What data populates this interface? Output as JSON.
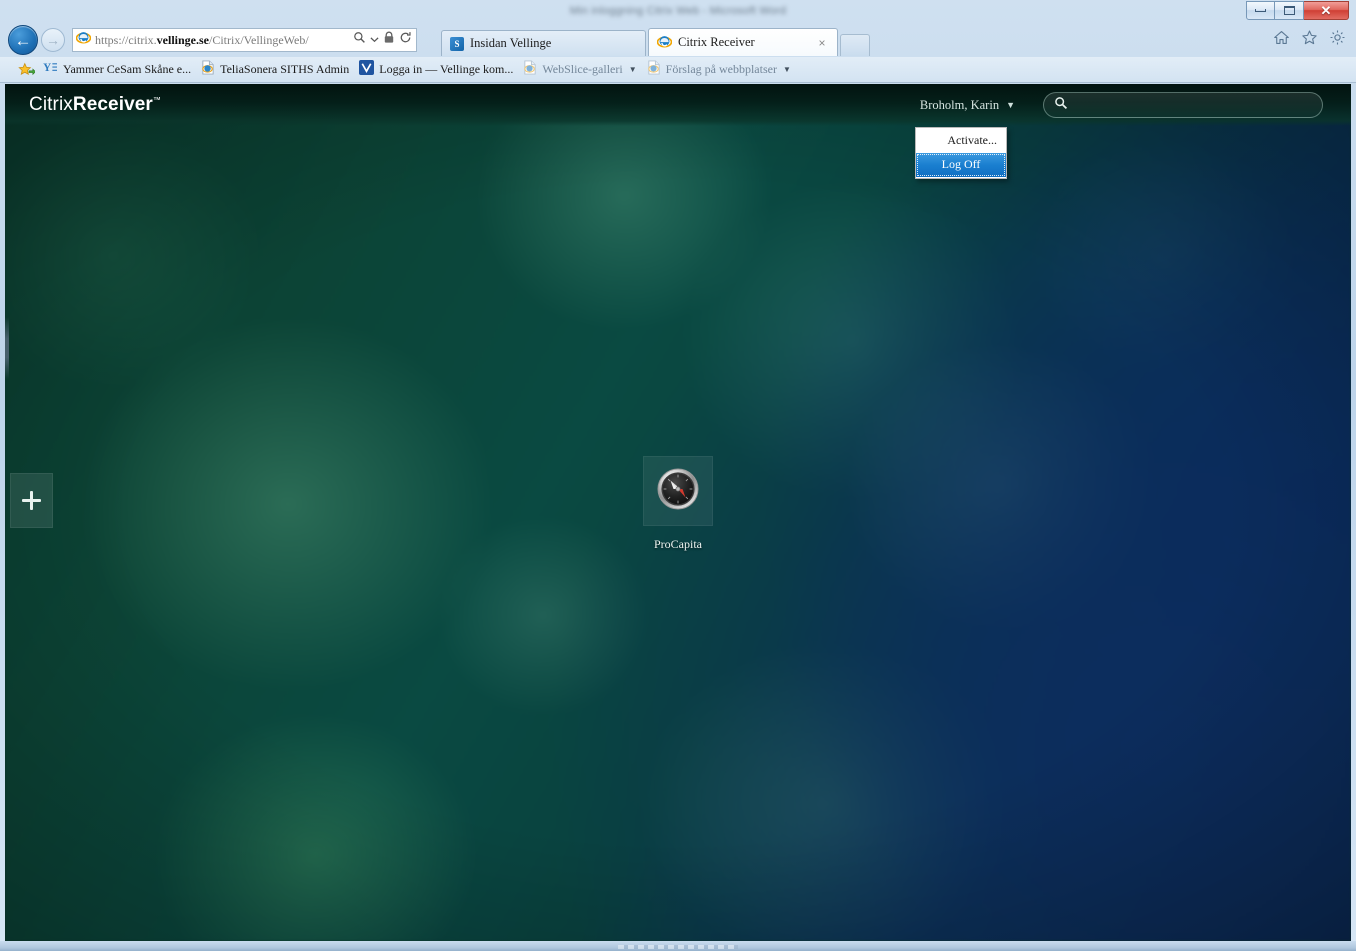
{
  "window": {
    "title": "Min inloggning Citrix Web - Microsoft Word",
    "minimize_label": "Minimize",
    "maximize_label": "Restore Down",
    "close_label": "Close"
  },
  "browser": {
    "back_label": "Back",
    "forward_label": "Forward",
    "url": "https://citrix.vellinge.se/Citrix/VellingeWeb/",
    "url_parts": {
      "scheme": "https://",
      "host_pre": "citrix.",
      "host_bold": "vellinge.se",
      "path": "/Citrix/VellingeWeb/"
    },
    "search_icon": "search-icon",
    "dropdown_icon": "chevron-down-icon",
    "lock_icon": "lock-icon",
    "refresh_icon": "refresh-icon",
    "tabs": [
      {
        "label": "Insidan Vellinge",
        "icon": "sharepoint-icon",
        "active": false,
        "closable": false
      },
      {
        "label": "Citrix Receiver",
        "icon": "ie-icon",
        "active": true,
        "closable": true,
        "close_label": "×"
      }
    ],
    "new_tab_label": "",
    "command_icons": [
      {
        "name": "home-icon",
        "label": "Home"
      },
      {
        "name": "favorites-star-icon",
        "label": "Favorites"
      },
      {
        "name": "gear-icon",
        "label": "Tools"
      }
    ],
    "favorites": [
      {
        "label": "Yammer  CeSam Skåne e...",
        "icon": "yammer-icon",
        "muted": false,
        "caret": false
      },
      {
        "label": "TeliaSonera SITHS Admin",
        "icon": "ie-page-icon",
        "muted": false,
        "caret": false
      },
      {
        "label": "Logga in — Vellinge kom...",
        "icon": "vellinge-icon",
        "muted": false,
        "caret": false
      },
      {
        "label": "WebSlice-galleri",
        "icon": "ie-page-icon",
        "muted": true,
        "caret": true
      },
      {
        "label": "Förslag på webbplatser",
        "icon": "ie-page-icon",
        "muted": true,
        "caret": true
      }
    ]
  },
  "citrix": {
    "brand_light": "Citrix",
    "brand_bold": "Receiver",
    "brand_tm": "™",
    "user_name": "Broholm, Karin",
    "user_caret": "▼",
    "search_placeholder": "",
    "search_value": "",
    "menu": [
      {
        "label": "Activate...",
        "selected": false
      },
      {
        "label": "Log Off",
        "selected": true
      }
    ],
    "apps": [
      {
        "label": "ProCapita",
        "icon": "compass-icon"
      }
    ],
    "add_button_label": "+",
    "colors": {
      "header_dark": "#021e18",
      "bg_green": "#0c4436",
      "bg_teal": "#0a4a42",
      "bg_blue": "#0a2647",
      "menu_highlight": "#1a7fd0",
      "accent_white": "#ffffff"
    }
  }
}
